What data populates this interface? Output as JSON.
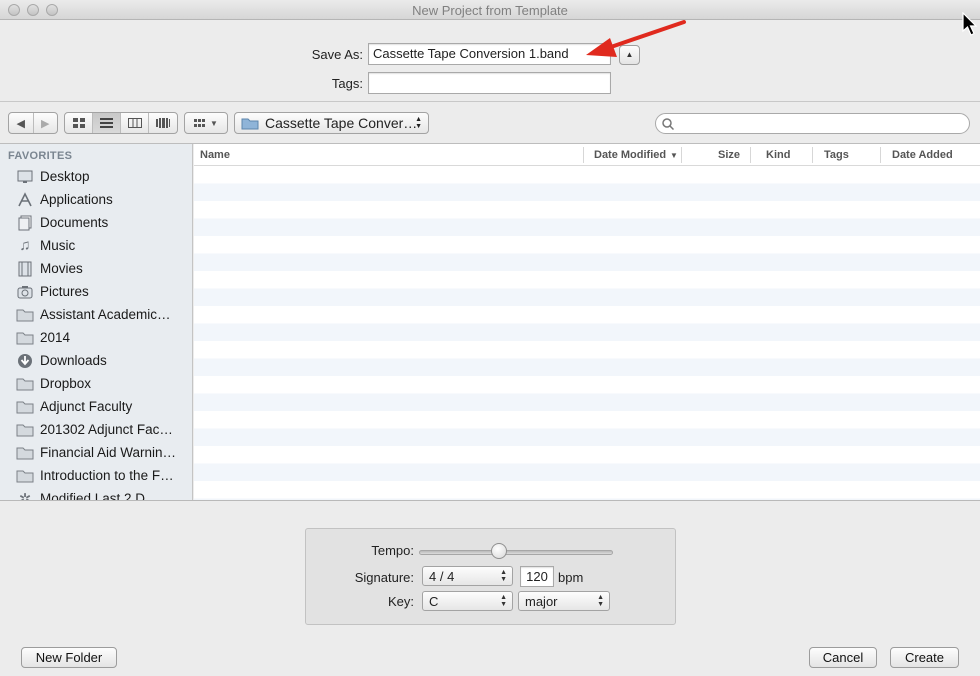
{
  "window": {
    "title": "New Project from Template"
  },
  "save": {
    "save_as_label": "Save As:",
    "filename": "Cassette Tape Conversion 1.band",
    "tags_label": "Tags:",
    "tags_value": ""
  },
  "toolbar": {
    "location": "Cassette Tape Conver…",
    "search_value": ""
  },
  "sidebar": {
    "header": "FAVORITES",
    "items": [
      {
        "label": "Desktop",
        "icon": "desktop-icon"
      },
      {
        "label": "Applications",
        "icon": "applications-icon"
      },
      {
        "label": "Documents",
        "icon": "documents-icon"
      },
      {
        "label": "Music",
        "icon": "music-icon"
      },
      {
        "label": "Movies",
        "icon": "movies-icon"
      },
      {
        "label": "Pictures",
        "icon": "camera-icon"
      },
      {
        "label": "Assistant Academic…",
        "icon": "folder-icon"
      },
      {
        "label": "2014",
        "icon": "folder-icon"
      },
      {
        "label": "Downloads",
        "icon": "download-icon"
      },
      {
        "label": "Dropbox",
        "icon": "folder-icon"
      },
      {
        "label": "Adjunct Faculty",
        "icon": "folder-icon"
      },
      {
        "label": "201302 Adjunct Fac…",
        "icon": "folder-icon"
      },
      {
        "label": "Financial Aid Warnin…",
        "icon": "folder-icon"
      },
      {
        "label": "Introduction to the F…",
        "icon": "folder-icon"
      },
      {
        "label": "Modified Last 2 D…",
        "icon": "gear-icon"
      }
    ]
  },
  "columns": {
    "name": "Name",
    "date_modified": "Date Modified",
    "size": "Size",
    "kind": "Kind",
    "tags": "Tags",
    "date_added": "Date Added"
  },
  "project": {
    "tempo_label": "Tempo:",
    "tempo_level": 0.41,
    "signature_label": "Signature:",
    "signature_value": "4 / 4",
    "bpm_value": "120",
    "bpm_unit": "bpm",
    "key_label": "Key:",
    "key_value": "C",
    "mode_value": "major"
  },
  "buttons": {
    "new_folder": "New Folder",
    "cancel": "Cancel",
    "create": "Create"
  },
  "colors": {
    "annotation_arrow": "#e02a1e",
    "row_stripe": "#f2f6fb"
  }
}
